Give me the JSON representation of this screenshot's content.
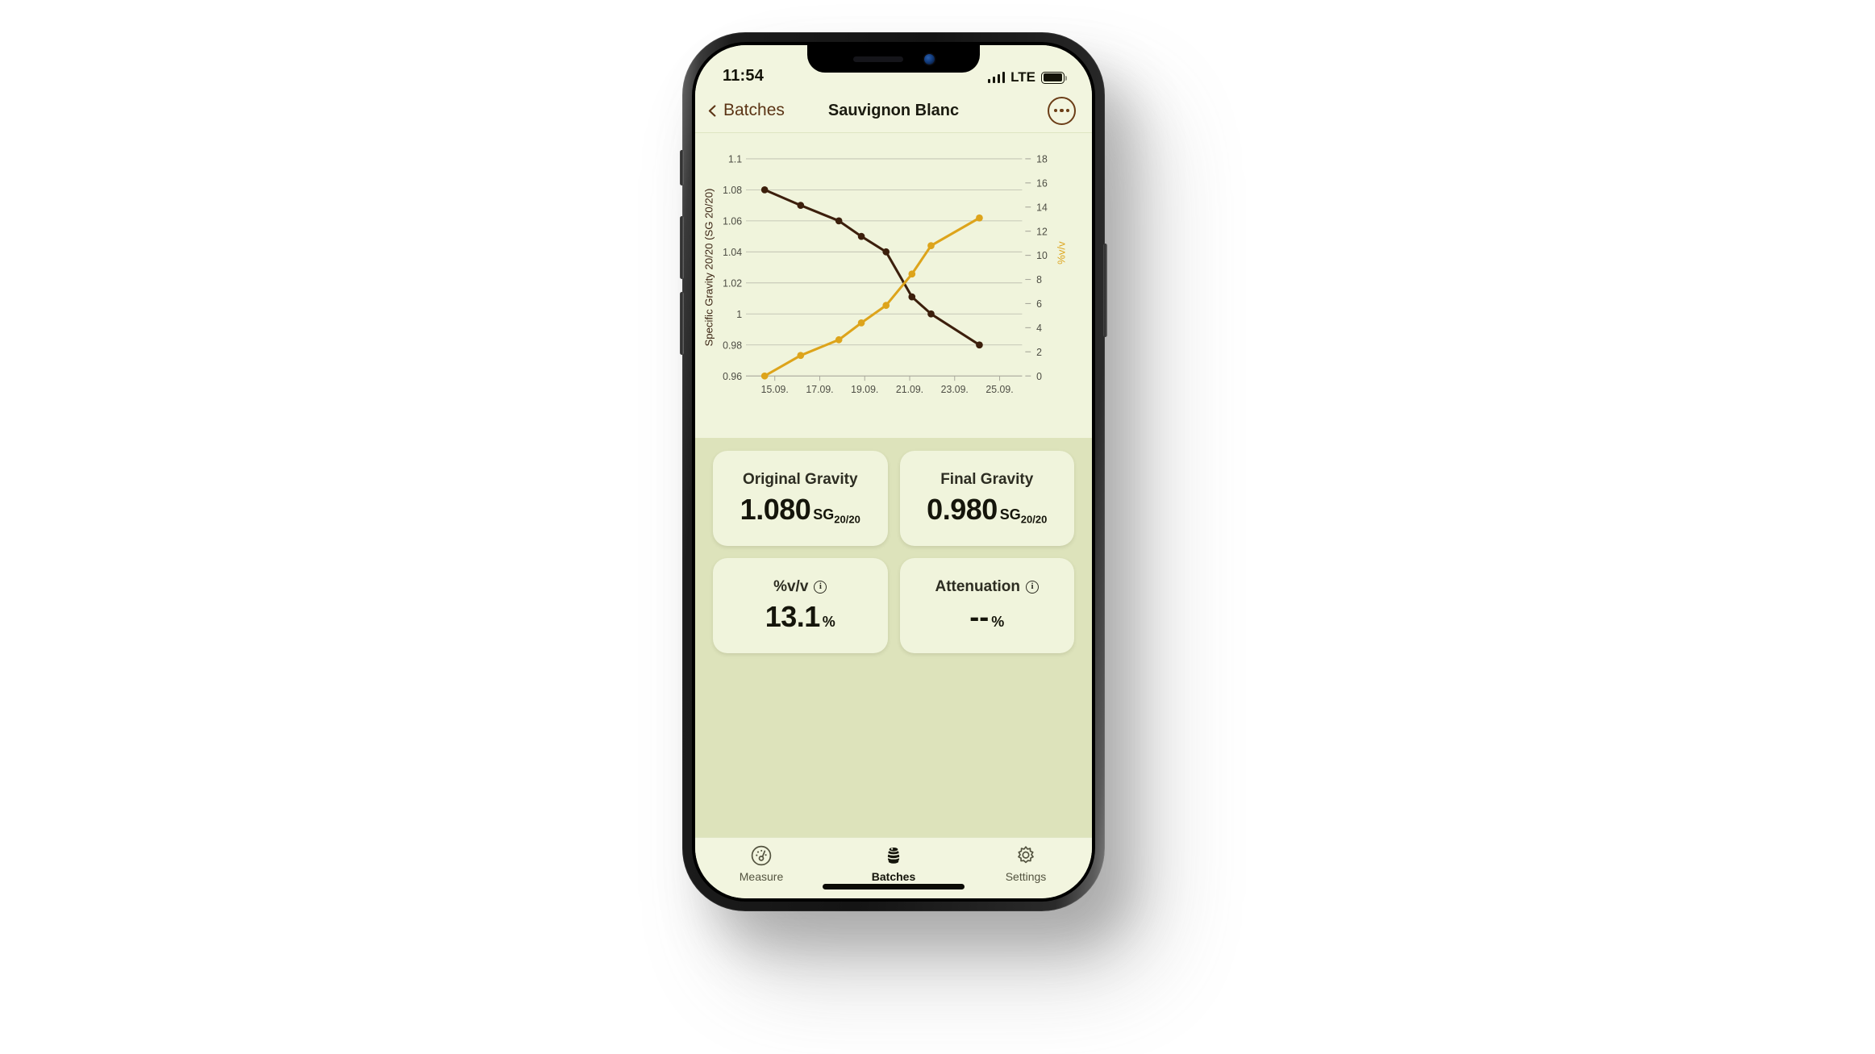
{
  "status_bar": {
    "time": "11:54",
    "carrier": "LTE",
    "signal_icon": "signal-bars-icon",
    "battery_icon": "battery-full-icon"
  },
  "nav_bar": {
    "back_label": "Batches",
    "back_icon": "chevron-left-icon",
    "title": "Sauvignon Blanc",
    "more_icon": "ellipsis-icon"
  },
  "chart_data": {
    "type": "line",
    "title": "",
    "xlabel": "",
    "ylabel": "Specific Gravity 20/20 (SG 20/20)",
    "y2label": "%v/v",
    "grid": true,
    "legend": "none",
    "x_tick_labels": [
      "15.09.",
      "17.09.",
      "19.09.",
      "21.09.",
      "23.09.",
      "25.09."
    ],
    "x_tick_values": [
      1,
      3,
      5,
      7,
      9,
      11
    ],
    "xlim": [
      0,
      12
    ],
    "ylim": [
      0.96,
      1.1
    ],
    "y_tick_labels": [
      "0.96",
      "0.98",
      "1",
      "1.02",
      "1.04",
      "1.06",
      "1.08",
      "1.1"
    ],
    "y_tick_values": [
      0.96,
      0.98,
      1.0,
      1.02,
      1.04,
      1.06,
      1.08,
      1.1
    ],
    "y2lim": [
      0,
      18
    ],
    "y2_tick_labels": [
      "0",
      "2",
      "4",
      "6",
      "8",
      "10",
      "12",
      "14",
      "16",
      "18"
    ],
    "y2_tick_values": [
      0,
      2,
      4,
      6,
      8,
      10,
      12,
      14,
      16,
      18
    ],
    "series": [
      {
        "name": "Specific Gravity 20/20 (SG 20/20)",
        "axis": "left",
        "color": "#3c1f0c",
        "x": [
          0.55,
          2.15,
          3.85,
          4.85,
          5.95,
          7.1,
          7.95,
          10.1
        ],
        "values": [
          1.08,
          1.07,
          1.06,
          1.05,
          1.04,
          1.011,
          1.0,
          0.98
        ]
      },
      {
        "name": "%v/v",
        "axis": "right",
        "color": "#dda41b",
        "x": [
          0.55,
          2.15,
          3.85,
          4.85,
          5.95,
          7.1,
          7.95,
          10.1
        ],
        "values": [
          0.0,
          1.7,
          3.0,
          4.4,
          5.85,
          8.45,
          10.8,
          13.1
        ]
      }
    ]
  },
  "stats": {
    "cards": [
      {
        "label": "Original Gravity",
        "has_info": false,
        "value": "1.080",
        "unit": "SG",
        "unit_sub": "20/20"
      },
      {
        "label": "Final Gravity",
        "has_info": false,
        "value": "0.980",
        "unit": "SG",
        "unit_sub": "20/20"
      },
      {
        "label": "%v/v",
        "has_info": true,
        "value": "13.1",
        "unit": "%",
        "unit_sub": ""
      },
      {
        "label": "Attenuation",
        "has_info": true,
        "value": "--",
        "unit": "%",
        "unit_sub": ""
      }
    ],
    "info_glyph": "i"
  },
  "tab_bar": {
    "tabs": [
      {
        "label": "Measure",
        "icon": "gauge-icon",
        "active": false
      },
      {
        "label": "Batches",
        "icon": "barrel-icon",
        "active": true
      },
      {
        "label": "Settings",
        "icon": "gear-icon",
        "active": false
      }
    ]
  },
  "colors": {
    "chart_bg": "#f0f4dc",
    "panel_bg": "#dde3bb",
    "screen_bg": "#f2f5df",
    "sg_line": "#3c1f0c",
    "abv_line": "#dda41b",
    "accent_brown": "#6b3d17",
    "grid": "#a9a99c"
  }
}
